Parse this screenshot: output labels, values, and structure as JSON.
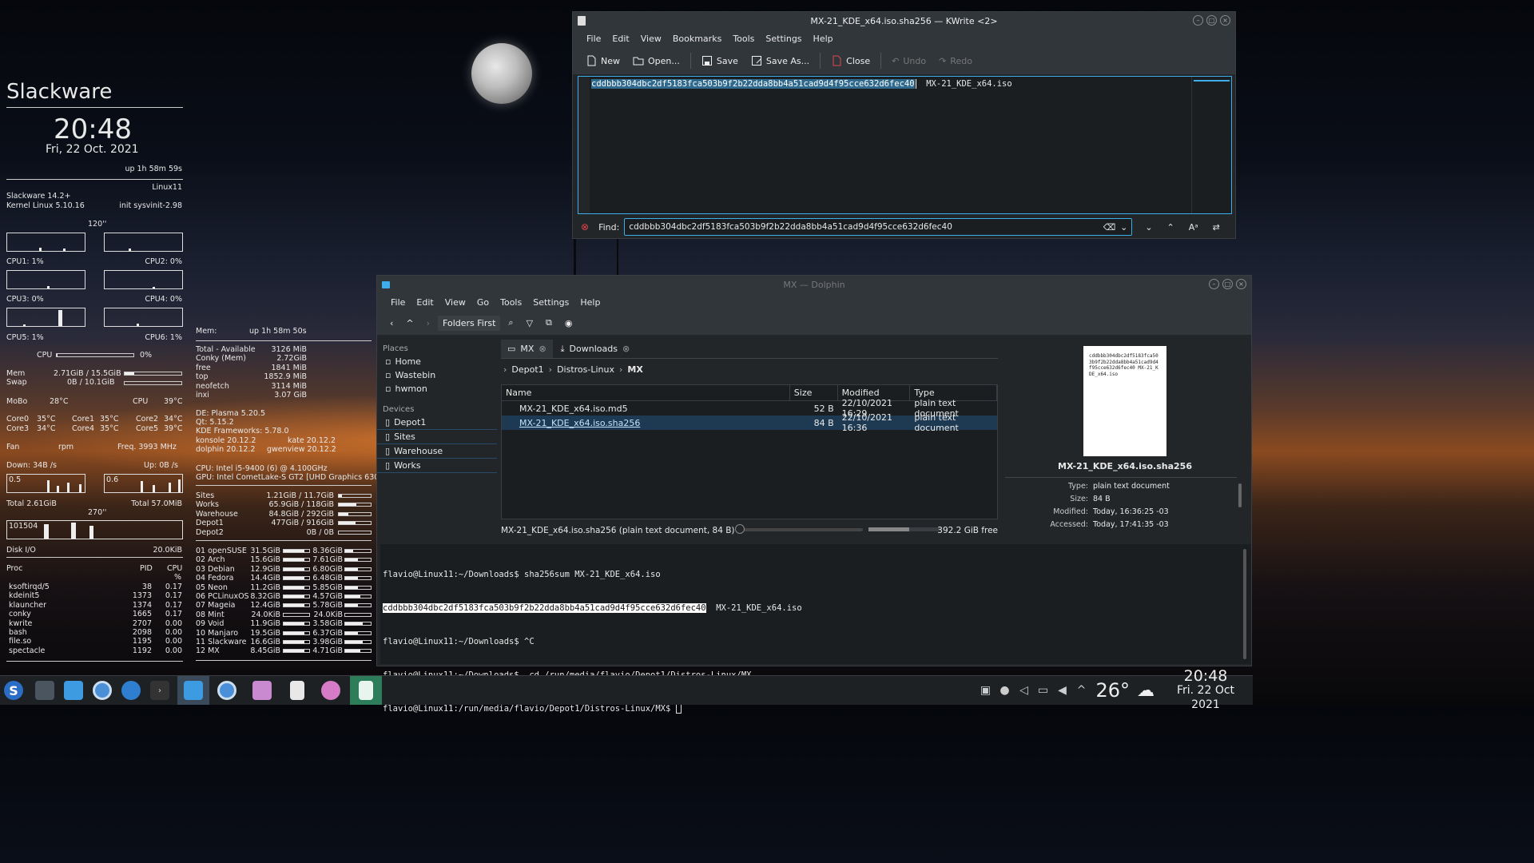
{
  "conky": {
    "title": "Slackware",
    "time": "20:48",
    "date": "Fri, 22 Oct. 2021",
    "uptime": "up  1h 58m 59s",
    "host": "Linux11",
    "distro": "Slackware 14.2+",
    "kernel": "Kernel Linux 5.10.16",
    "init": "init  sysvinit-2.98",
    "deg120": "120''",
    "cpu1": "CPU1: 1%",
    "cpu2": "CPU2: 0%",
    "cpu3": "CPU3: 0%",
    "cpu4": "CPU4: 0%",
    "cpu5": "CPU5: 1%",
    "cpu6": "CPU6: 1%",
    "cpu_label": "CPU",
    "cpu_pct": "0%",
    "mem_label": "Mem",
    "mem_val": "2.71GiB / 15.5GiB",
    "swap_label": "Swap",
    "swap_val": "0B   / 10.1GiB",
    "mobo": "MoBo",
    "mobo_t": "28°C",
    "cpu_t_label": "CPU",
    "cpu_t": "39°C",
    "core0": "Core0",
    "core0_t": "35°C",
    "core1": "Core1",
    "core1_t": "35°C",
    "core2": "Core2",
    "core2_t": "34°C",
    "core3": "Core3",
    "core3_t": "34°C",
    "core4": "Core4",
    "core4_t": "35°C",
    "core5": "Core5",
    "core5_t": "39°C",
    "fan": "Fan",
    "rpm": "rpm",
    "freq": "Freq.  3993  MHz",
    "down": "Down: 34B  /s",
    "up": "Up: 0B  /s",
    "g_down": "0.5",
    "g_up": "0.6",
    "total_down": "Total 2.61GiB",
    "total_up": "Total 57.0MiB",
    "deg270": "270''",
    "disk_graph": "101504",
    "disk_io": "Disk I/O",
    "disk_io_val": "20.0KiB",
    "proc_h": "Proc",
    "pid_h": "PID",
    "cpu_h": "CPU",
    "pct_h": "%",
    "procs": [
      [
        "ksoftirqd/5",
        "38",
        "0.17"
      ],
      [
        "kdeinit5",
        "1373",
        "0.17"
      ],
      [
        "klauncher",
        "1374",
        "0.17"
      ],
      [
        "conky",
        "1665",
        "0.17"
      ],
      [
        "kwrite",
        "2707",
        "0.00"
      ],
      [
        "bash",
        "2098",
        "0.00"
      ],
      [
        "file.so",
        "1195",
        "0.00"
      ],
      [
        "spectacle",
        "1192",
        "0.00"
      ]
    ],
    "mem2": "Mem:",
    "mem2_up": "up  1h 58m 50s",
    "memrows": [
      [
        "Total - Available",
        "3126 MiB"
      ],
      [
        "Conky (Mem)",
        "2.72GiB"
      ],
      [
        "free",
        "1841   MiB"
      ],
      [
        "top",
        "1852.9  MiB"
      ],
      [
        "neofetch",
        "3114 MiB"
      ],
      [
        "inxi",
        "3.07 GiB"
      ]
    ],
    "de": "DE: Plasma 5.20.5",
    "qt": "Qt: 5.15.2",
    "kf": "KDE Frameworks: 5.78.0",
    "konsole": "konsole 20.12.2",
    "kate": "kate 20.12.2",
    "dolphin": "dolphin 20.12.2",
    "gwenview": "gwenview 20.12.2",
    "cpuinfo": "CPU: Intel i5-9400 (6) @ 4.100GHz",
    "gpuinfo": "GPU: Intel CometLake-S GT2 [UHD Graphics 630]",
    "drives": [
      [
        "Sites",
        "1.21GiB  /  11.7GiB",
        0.1
      ],
      [
        "Works",
        "65.9GiB  /   118GiB",
        0.56
      ],
      [
        "Warehouse",
        "84.8GiB  /  292GiB",
        0.29
      ],
      [
        "Depot1",
        "477GiB  /  916GiB",
        0.52
      ],
      [
        "Depot2",
        "0B   /   0B",
        0
      ]
    ],
    "distros": [
      [
        "01 openSUSE",
        "31.5GiB",
        0.8,
        "8.36GiB",
        0.3
      ],
      [
        "02 Arch",
        "15.6GiB",
        0.8,
        "7.61GiB",
        0.5
      ],
      [
        "03 Debian",
        "12.9GiB",
        0.8,
        "6.80GiB",
        0.5
      ],
      [
        "04 Fedora",
        "14.4GiB",
        0.8,
        "6.48GiB",
        0.5
      ],
      [
        "05 Neon",
        "11.2GiB",
        0.8,
        "5.85GiB",
        0.5
      ],
      [
        "06 PCLinuxOS",
        "8.32GiB",
        0.8,
        "4.57GiB",
        0.6
      ],
      [
        "07 Mageia",
        "12.4GiB",
        0.8,
        "5.78GiB",
        0.5
      ],
      [
        "08 Mint",
        "24.0KiB",
        0,
        "24.0KiB",
        0
      ],
      [
        "09 Void",
        "11.9GiB",
        0.8,
        "3.58GiB",
        0.7
      ],
      [
        "10 Manjaro",
        "19.5GiB",
        0.8,
        "6.37GiB",
        0.5
      ],
      [
        "11 Slackware",
        "16.6GiB",
        0.8,
        "3.98GiB",
        0.7
      ],
      [
        "12 MX",
        "8.45GiB",
        0.8,
        "4.71GiB",
        0.6
      ]
    ]
  },
  "kwrite": {
    "title": "MX-21_KDE_x64.iso.sha256 — KWrite <2>",
    "menu": [
      "File",
      "Edit",
      "View",
      "Bookmarks",
      "Tools",
      "Settings",
      "Help"
    ],
    "tb": {
      "new": "New",
      "open": "Open...",
      "save": "Save",
      "saveas": "Save As...",
      "close": "Close",
      "undo": "Undo",
      "redo": "Redo"
    },
    "hash": "cddbbb304dbc2df5183fca503b9f2b22dda8bb4a51cad9d4f95cce632d6fec40",
    "file": "MX-21_KDE_x64.iso",
    "find_label": "Find:",
    "find_value": "cddbbb304dbc2df5183fca503b9f2b22dda8bb4a51cad9d4f95cce632d6fec40"
  },
  "dolphin": {
    "title": "MX — Dolphin",
    "menu": [
      "File",
      "Edit",
      "View",
      "Go",
      "Tools",
      "Settings",
      "Help"
    ],
    "folders_first": "Folders First",
    "places_h": "Places",
    "places": [
      "Home",
      "Wastebin",
      "hwmon"
    ],
    "devices_h": "Devices",
    "devices": [
      "Depot1",
      "Sites",
      "Warehouse",
      "Works"
    ],
    "tab1": "MX",
    "tab2": "Downloads",
    "crumbs": [
      "Depot1",
      "Distros-Linux",
      "MX"
    ],
    "cols": [
      "Name",
      "Size",
      "Modified",
      "Type"
    ],
    "rows": [
      [
        "MX-21_KDE_x64.iso.md5",
        "52 B",
        "22/10/2021 16:29",
        "plain text document"
      ],
      [
        "MX-21_KDE_x64.iso.sha256",
        "84 B",
        "22/10/2021 16:36",
        "plain text document"
      ]
    ],
    "status": "MX-21_KDE_x64.iso.sha256 (plain text document, 84 B)",
    "free": "392.2 GiB free",
    "preview_text": "cddbbb304dbc2df5183fca503b9f2b22dda8bb4a51cad9d4f95cce632d6fec40 MX-21_KDE_x64.iso",
    "info_name": "MX-21_KDE_x64.iso.sha256",
    "info": [
      [
        "Type:",
        "plain text document"
      ],
      [
        "Size:",
        "84 B"
      ],
      [
        "Modified:",
        "Today, 16:36:25 -03"
      ],
      [
        "Accessed:",
        "Today, 17:41:35 -03"
      ]
    ],
    "term": [
      "flavio@Linux11:~/Downloads$ sha256sum MX-21_KDE_x64.iso",
      "  MX-21_KDE_x64.iso",
      "flavio@Linux11:~/Downloads$ ^C",
      "flavio@Linux11:~/Downloads$  cd /run/media/flavio/Depot1/Distros-Linux/MX",
      "flavio@Linux11:/run/media/flavio/Depot1/Distros-Linux/MX$ "
    ],
    "term_hash": "cddbbb304dbc2df5183fca503b9f2b22dda8bb4a51cad9d4f95cce632d6fec40"
  },
  "tray": {
    "temp": "26°",
    "clock": "20:48",
    "date": "Fri. 22 Oct 2021"
  }
}
